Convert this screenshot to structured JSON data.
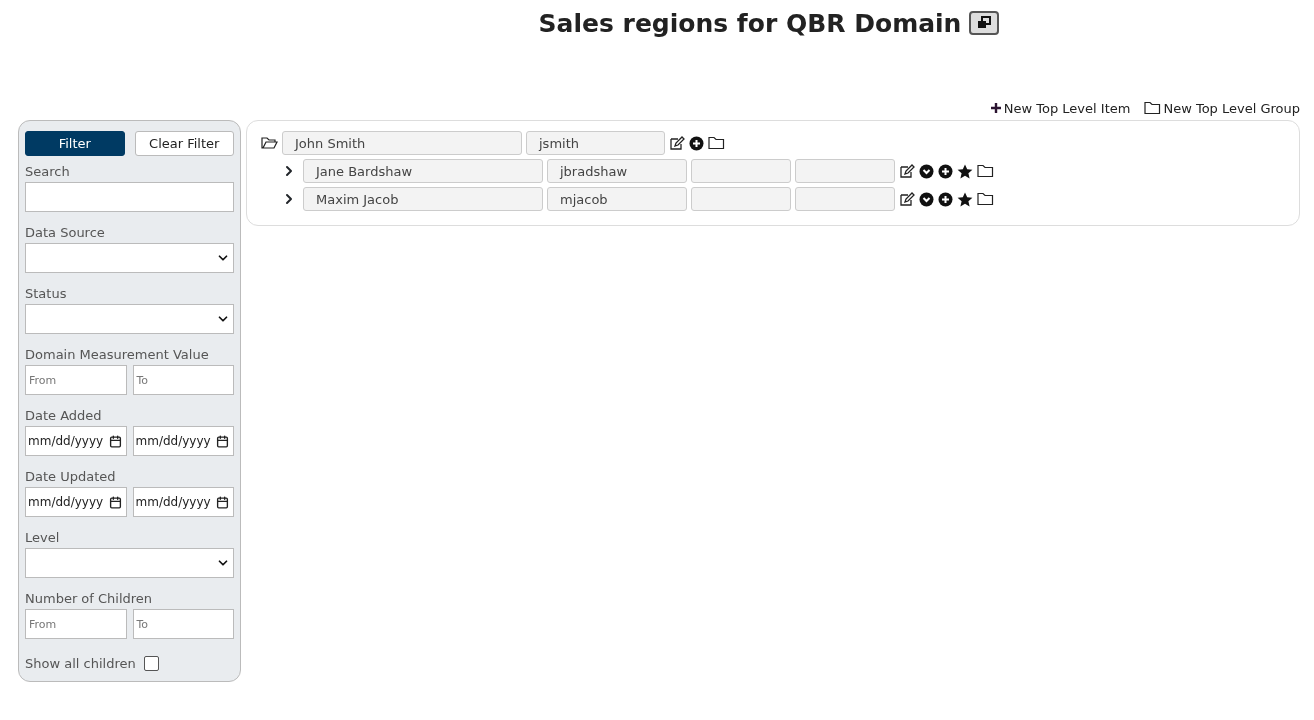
{
  "title": "Sales regions for QBR Domain",
  "top_actions": [
    {
      "kind": "item",
      "label": "New Top Level Item"
    },
    {
      "kind": "group",
      "label": "New Top Level Group"
    }
  ],
  "filter_panel": {
    "filter_button": "Filter",
    "clear_button": "Clear Filter",
    "fields": [
      {
        "kind": "text",
        "label": "Search"
      },
      {
        "kind": "select",
        "label": "Data Source"
      },
      {
        "kind": "select",
        "label": "Status"
      },
      {
        "kind": "range",
        "label": "Domain Measurement Value",
        "placeholders": [
          "From",
          "To"
        ]
      },
      {
        "kind": "date_range",
        "label": "Date Added",
        "placeholders": [
          "mm/dd/yyyy",
          "mm/dd/yyyy"
        ]
      },
      {
        "kind": "date_range",
        "label": "Date Updated",
        "placeholders": [
          "mm/dd/yyyy",
          "mm/dd/yyyy"
        ]
      },
      {
        "kind": "select",
        "label": "Level"
      },
      {
        "kind": "range",
        "label": "Number of Children",
        "placeholders": [
          "From",
          "To"
        ]
      },
      {
        "kind": "checkbox",
        "label": "Show all children",
        "checked": false
      }
    ]
  },
  "tree": [
    {
      "kind": "group",
      "expanded": true,
      "name": "John Smith",
      "username": "jsmith",
      "children": [
        {
          "kind": "item",
          "expanded": false,
          "name": "Jane Bardshaw",
          "username": "jbradshaw"
        },
        {
          "kind": "item",
          "expanded": false,
          "name": "Maxim Jacob",
          "username": "mjacob"
        }
      ]
    }
  ]
}
